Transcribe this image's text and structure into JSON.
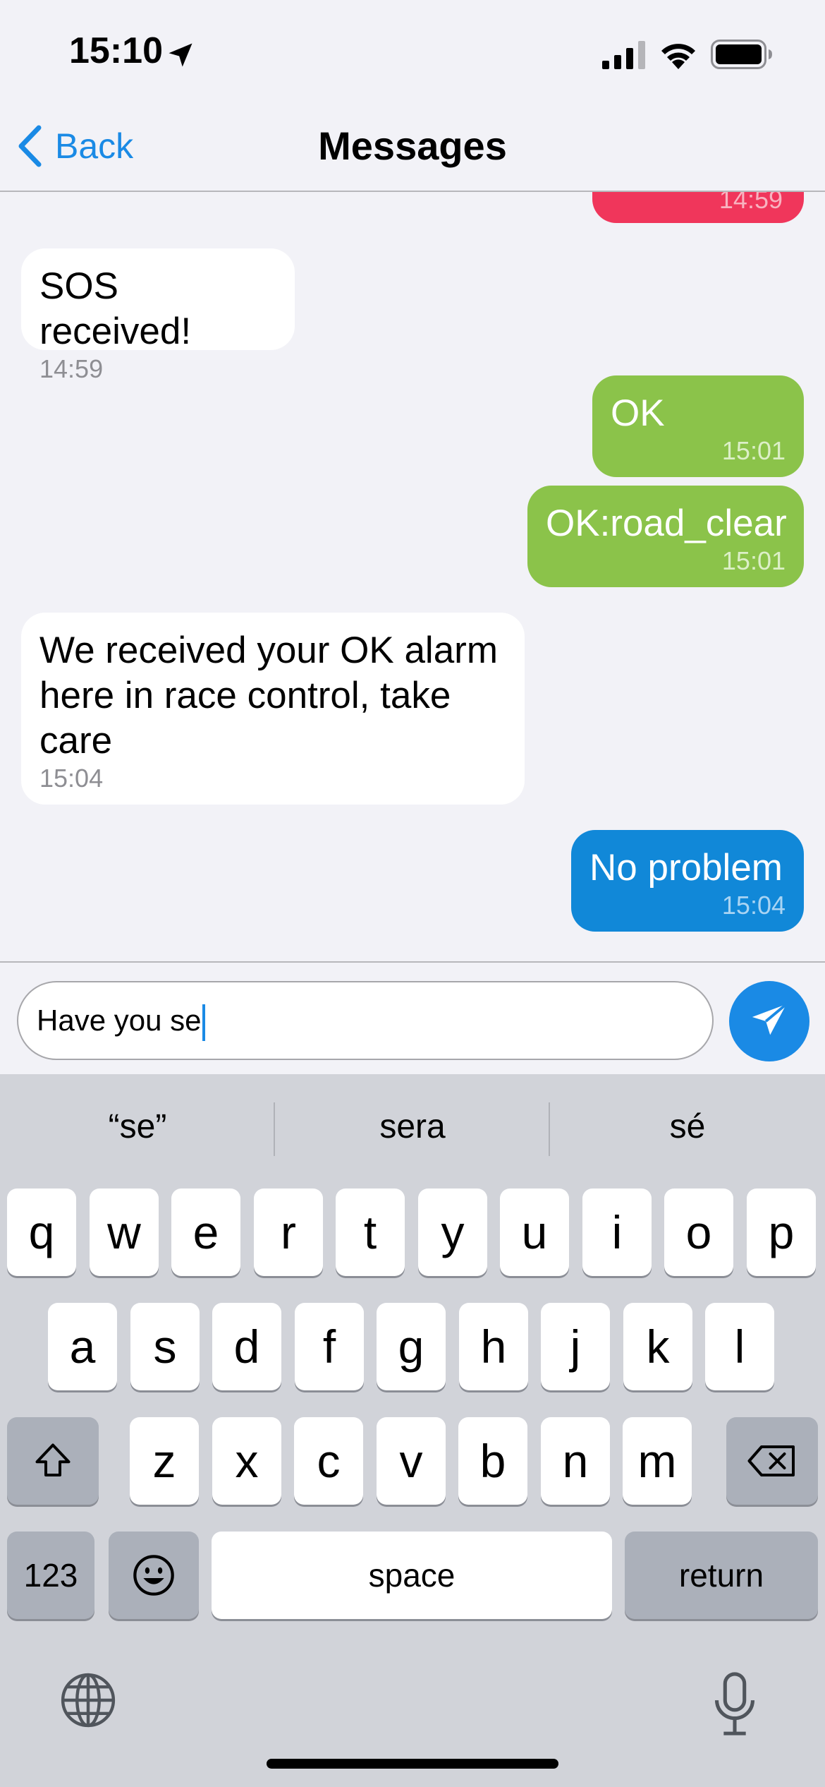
{
  "status_bar": {
    "time": "15:10",
    "icons": [
      "location-arrow-icon",
      "cellular-signal-icon",
      "wifi-icon",
      "battery-icon"
    ]
  },
  "nav": {
    "back_label": "Back",
    "title": "Messages"
  },
  "messages": [
    {
      "direction": "outgoing",
      "color": "#f0365b",
      "text": "",
      "time": "14:59"
    },
    {
      "direction": "incoming",
      "color": "#ffffff",
      "text": "SOS received!",
      "time": "14:59"
    },
    {
      "direction": "outgoing",
      "color": "#8bc34a",
      "text": "OK",
      "time": "15:01"
    },
    {
      "direction": "outgoing",
      "color": "#8bc34a",
      "text": "OK:road_clear",
      "time": "15:01"
    },
    {
      "direction": "incoming",
      "color": "#ffffff",
      "text": "We received your OK alarm here in race control, take care",
      "time": "15:04"
    },
    {
      "direction": "outgoing",
      "color": "#1188d8",
      "text": "No problem",
      "time": "15:04"
    }
  ],
  "composer": {
    "value": "Have you se",
    "send_icon": "paper-plane-icon"
  },
  "keyboard": {
    "suggestions": [
      "“se”",
      "sera",
      "sé"
    ],
    "row1": [
      "q",
      "w",
      "e",
      "r",
      "t",
      "y",
      "u",
      "i",
      "o",
      "p"
    ],
    "row2": [
      "a",
      "s",
      "d",
      "f",
      "g",
      "h",
      "j",
      "k",
      "l"
    ],
    "row3": [
      "z",
      "x",
      "c",
      "v",
      "b",
      "n",
      "m"
    ],
    "numbers_label": "123",
    "space_label": "space",
    "return_label": "return",
    "icons": [
      "shift-icon",
      "backspace-icon",
      "emoji-icon",
      "globe-icon",
      "microphone-icon"
    ]
  },
  "colors": {
    "accent": "#1a8ae5",
    "sos_red": "#f0365b",
    "ok_green": "#8bc34a",
    "message_blue": "#1188d8"
  }
}
